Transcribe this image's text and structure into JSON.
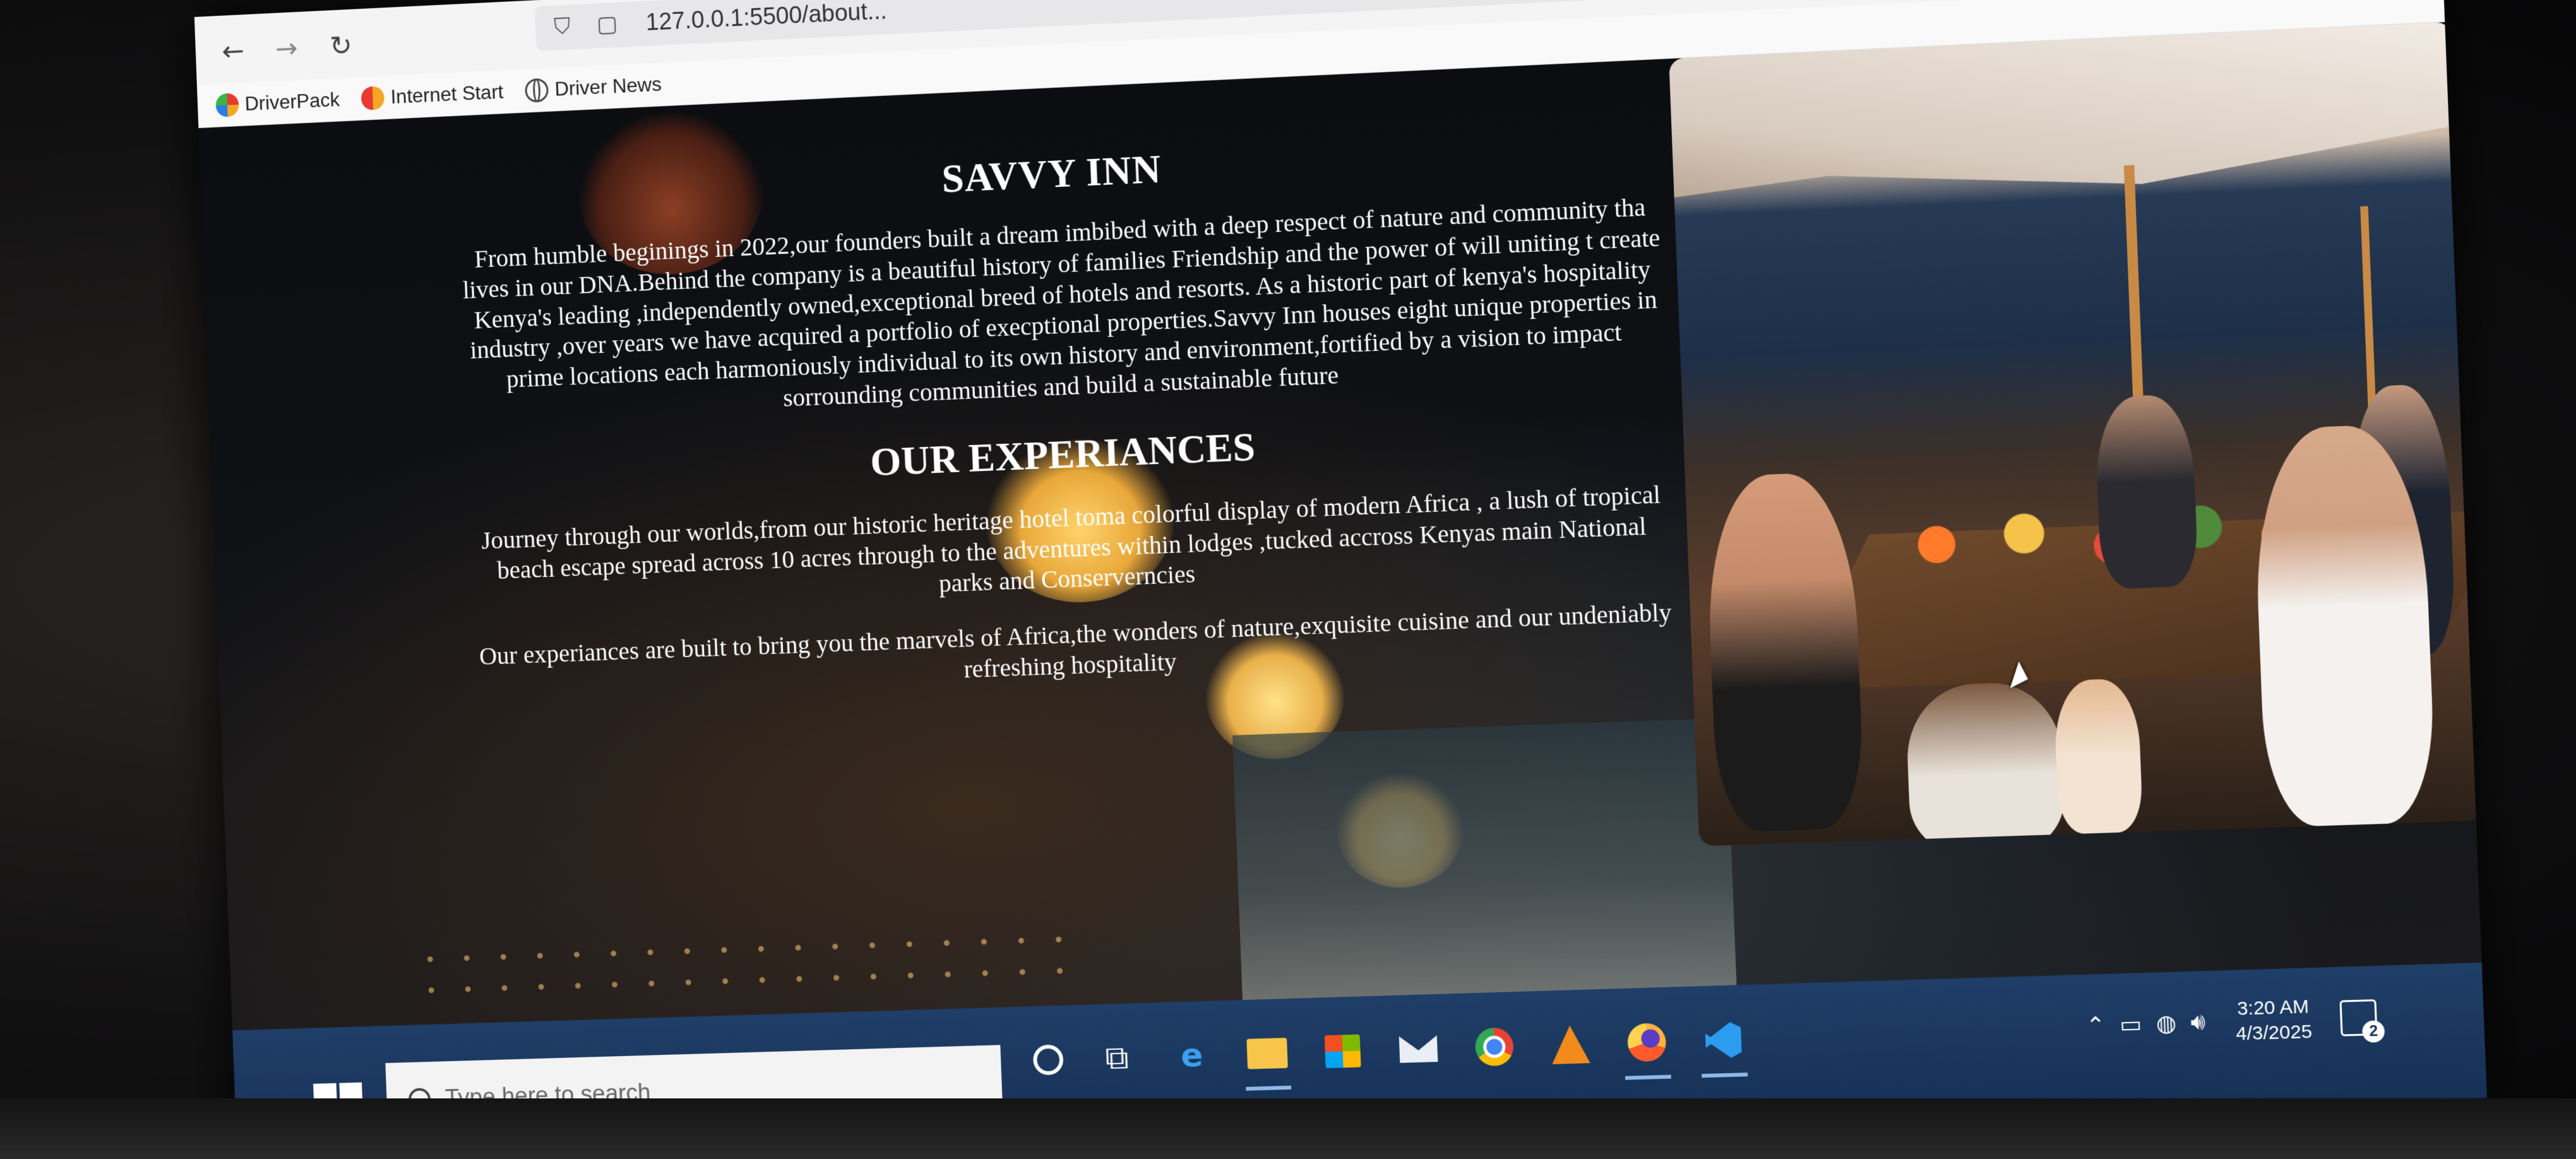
{
  "browser": {
    "back_icon": "arrow-left",
    "forward_icon": "arrow-right",
    "reload_icon": "reload",
    "url": "127.0.0.1:5500/about...",
    "bookmarks": [
      {
        "label": "DriverPack",
        "icon": "driverpack-icon"
      },
      {
        "label": "Internet Start",
        "icon": "internet-start-icon"
      },
      {
        "label": "Driver News",
        "icon": "globe-icon"
      }
    ]
  },
  "page": {
    "title": "SAVVY INN",
    "about": "From humble beginings in 2022,our founders built a dream imbibed with a deep respect of nature and community tha lives in our DNA.Behind the company is a beautiful history of families Friendship and the power of will uniting t create Kenya's leading ,independently owned,exceptional breed of hotels and resorts. As a historic part of kenya's hospitality industry ,over years we have acquired a portfolio of execptional properties.Savvy Inn houses eight unique properties in prime locations each harmoniously individual to its own history and environment,fortified by a vision to impact sorrounding communities and build a sustainable future",
    "experiences_title": "OUR EXPERIANCES",
    "experiences_p1": "Journey through our worlds,from our historic heritage hotel toma colorful display of modern Africa , a lush of tropical beach escape spread across 10 acres through to the adventures within lodges ,tucked accross Kenyas main National parks and Conserverncies",
    "experiences_p2": "Our experiances are built to bring you the marvels of Africa,the wonders of nature,exquisite cuisine and our undeniably refreshing hospitality"
  },
  "taskbar": {
    "search_placeholder": "Type here to search",
    "apps": [
      "cortana",
      "task-view",
      "edge",
      "file-explorer",
      "store",
      "mail",
      "chrome",
      "vlc",
      "firefox",
      "vscode"
    ],
    "active_apps": [
      "file-explorer",
      "firefox",
      "vscode"
    ],
    "clock_time": "3:20 AM",
    "clock_date": "4/3/2025",
    "notification_count": "2"
  },
  "colors": {
    "taskbar": "#1f3e68",
    "page_background": "#0d0e12",
    "text": "#ffffff"
  }
}
